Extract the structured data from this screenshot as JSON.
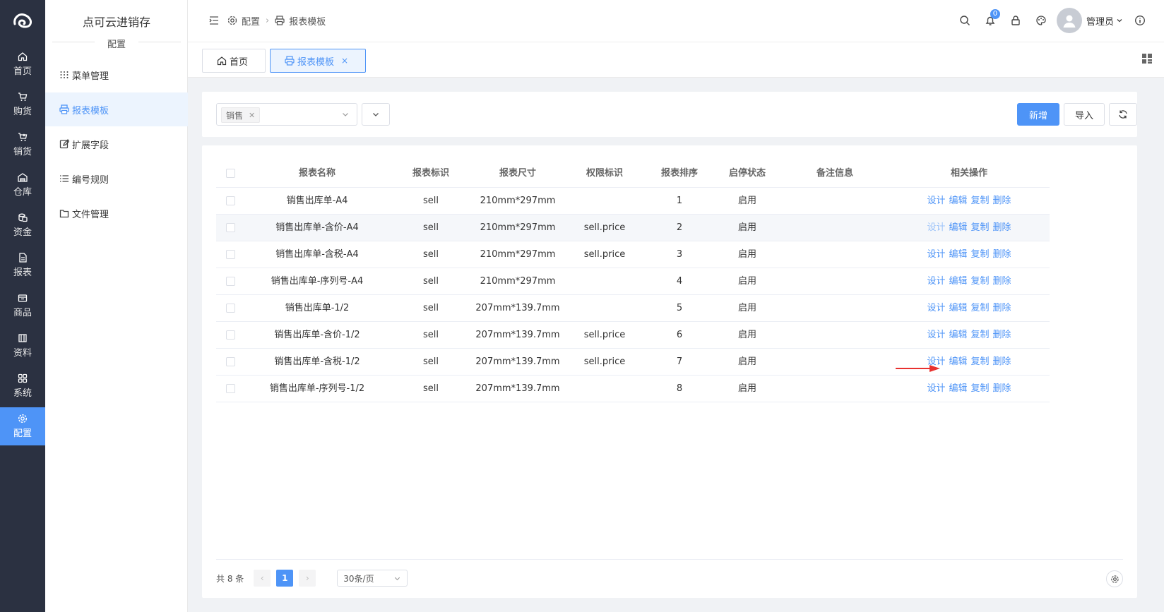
{
  "app": {
    "title": "点可云进销存",
    "section_caption": "配置"
  },
  "rail": {
    "items": [
      {
        "label": "首页",
        "icon": "home-icon"
      },
      {
        "label": "购货",
        "icon": "cart-icon"
      },
      {
        "label": "销货",
        "icon": "cart-arrow-icon"
      },
      {
        "label": "仓库",
        "icon": "warehouse-icon"
      },
      {
        "label": "资金",
        "icon": "coins-icon"
      },
      {
        "label": "报表",
        "icon": "report-icon"
      },
      {
        "label": "商品",
        "icon": "box-icon"
      },
      {
        "label": "资料",
        "icon": "book-icon"
      },
      {
        "label": "系统",
        "icon": "grid-icon"
      },
      {
        "label": "配置",
        "icon": "gear-icon"
      }
    ],
    "active_index": 9
  },
  "submenu": {
    "items": [
      {
        "label": "菜单管理",
        "icon": "dots-grid-icon"
      },
      {
        "label": "报表模板",
        "icon": "printer-icon"
      },
      {
        "label": "扩展字段",
        "icon": "edit-square-icon"
      },
      {
        "label": "编号规则",
        "icon": "list-icon"
      },
      {
        "label": "文件管理",
        "icon": "folder-icon"
      }
    ],
    "active_index": 1
  },
  "header": {
    "breadcrumb": [
      "配置",
      "报表模板"
    ],
    "notification_count": "0",
    "user_name": "管理员"
  },
  "tabs": [
    {
      "label": "首页",
      "icon": "home-icon"
    },
    {
      "label": "报表模板",
      "icon": "printer-icon",
      "active": true
    }
  ],
  "filter": {
    "selected_chip": "销售",
    "add_button": "新增",
    "import_button": "导入"
  },
  "table": {
    "columns": [
      "报表名称",
      "报表标识",
      "报表尺寸",
      "权限标识",
      "报表排序",
      "启停状态",
      "备注信息",
      "相关操作"
    ],
    "actions": [
      "设计",
      "编辑",
      "复制",
      "删除"
    ],
    "rows": [
      {
        "name": "销售出库单-A4",
        "key": "sell",
        "size": "210mm*297mm",
        "perm": "",
        "order": "1",
        "status": "启用",
        "remark": ""
      },
      {
        "name": "销售出库单-含价-A4",
        "key": "sell",
        "size": "210mm*297mm",
        "perm": "sell.price",
        "order": "2",
        "status": "启用",
        "remark": ""
      },
      {
        "name": "销售出库单-含税-A4",
        "key": "sell",
        "size": "210mm*297mm",
        "perm": "sell.price",
        "order": "3",
        "status": "启用",
        "remark": ""
      },
      {
        "name": "销售出库单-序列号-A4",
        "key": "sell",
        "size": "210mm*297mm",
        "perm": "",
        "order": "4",
        "status": "启用",
        "remark": ""
      },
      {
        "name": "销售出库单-1/2",
        "key": "sell",
        "size": "207mm*139.7mm",
        "perm": "",
        "order": "5",
        "status": "启用",
        "remark": ""
      },
      {
        "name": "销售出库单-含价-1/2",
        "key": "sell",
        "size": "207mm*139.7mm",
        "perm": "sell.price",
        "order": "6",
        "status": "启用",
        "remark": ""
      },
      {
        "name": "销售出库单-含税-1/2",
        "key": "sell",
        "size": "207mm*139.7mm",
        "perm": "sell.price",
        "order": "7",
        "status": "启用",
        "remark": ""
      },
      {
        "name": "销售出库单-序列号-1/2",
        "key": "sell",
        "size": "207mm*139.7mm",
        "perm": "",
        "order": "8",
        "status": "启用",
        "remark": ""
      }
    ],
    "hover_row_index": 1
  },
  "pagination": {
    "total_text": "共 8 条",
    "current_page": "1",
    "page_size": "30条/页"
  },
  "colors": {
    "accent": "#4e94f7",
    "rail_bg": "#2b3141",
    "annotation_arrow": "#e8312f"
  }
}
